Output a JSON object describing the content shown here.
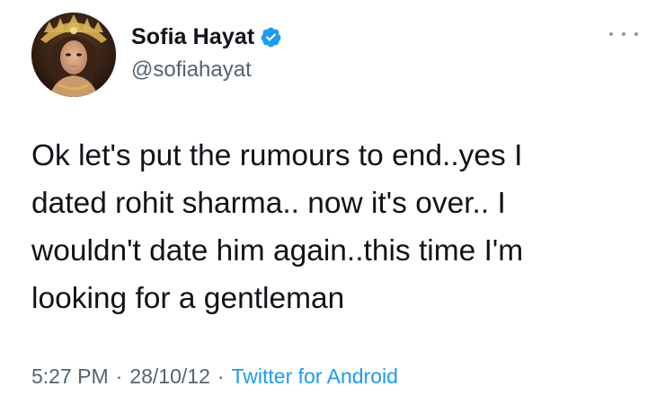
{
  "user": {
    "display_name": "Sofia Hayat",
    "handle": "@sofiahayat",
    "verified": true,
    "verified_badge_color": "#1d9bf0"
  },
  "tweet": {
    "text": "Ok let's put the rumours to end..yes I\ndated rohit sharma.. now it's over.. I\nwouldn't date him again..this time I'm\nlooking for a gentleman"
  },
  "meta": {
    "time": "5:27 PM",
    "separator": "·",
    "date": "28/10/12",
    "source": "Twitter for Android"
  },
  "icons": {
    "more": "more-horizontal-icon",
    "verified": "verified-badge-icon"
  },
  "colors": {
    "text_primary": "#0f1419",
    "text_secondary": "#536471",
    "link": "#1d9bf0"
  }
}
